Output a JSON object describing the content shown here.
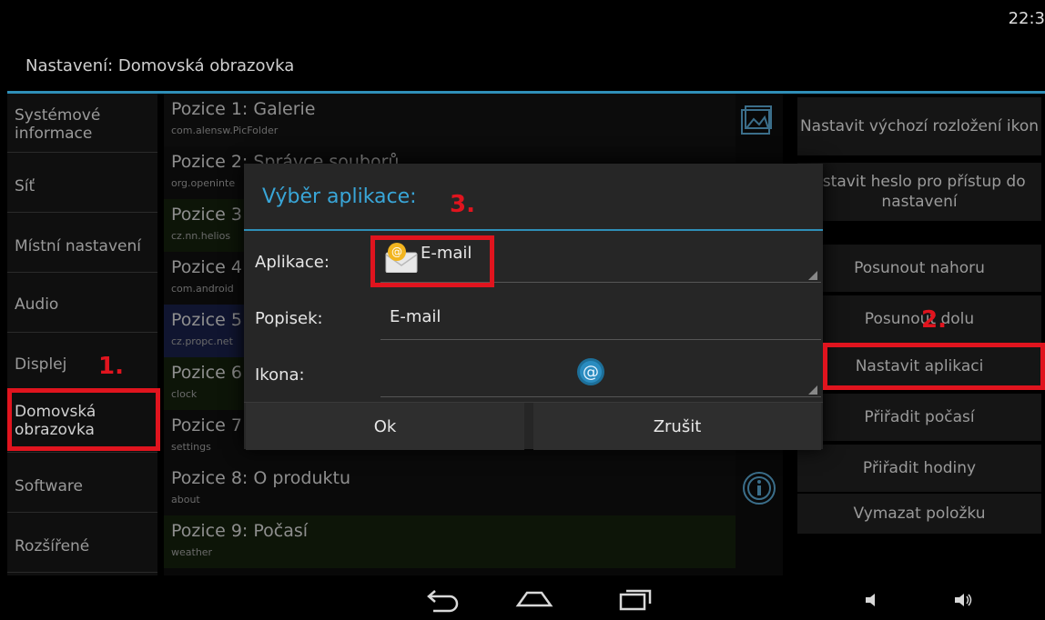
{
  "status_bar": {
    "clock": "22:3"
  },
  "header": {
    "title": "Nastavení: Domovská obrazovka"
  },
  "sidebar": {
    "items": [
      {
        "label": "Systémové informace"
      },
      {
        "label": "Síť"
      },
      {
        "label": "Místní nastavení"
      },
      {
        "label": "Audio"
      },
      {
        "label": "Displej"
      },
      {
        "label": "Domovská obrazovka"
      },
      {
        "label": "Software"
      },
      {
        "label": "Rozšířené"
      }
    ]
  },
  "positions": [
    {
      "name": "Pozice 1: Galerie",
      "package": "com.alensw.PicFolder",
      "icon": "gallery-icon"
    },
    {
      "name": "Pozice 2: Správce souborů",
      "package": "org.openinte"
    },
    {
      "name": "Pozice 3",
      "package": "cz.nn.helios"
    },
    {
      "name": "Pozice 4",
      "package": "com.android"
    },
    {
      "name": "Pozice 5",
      "package": "cz.propc.net"
    },
    {
      "name": "Pozice 6",
      "package": "clock"
    },
    {
      "name": "Pozice 7",
      "package": "settings"
    },
    {
      "name": "Pozice 8: O produktu",
      "package": "about",
      "icon": "info-icon"
    },
    {
      "name": "Pozice 9: Počasí",
      "package": "weather"
    }
  ],
  "actions": {
    "set_default_layout": "Nastavit výchozí rozložení ikon",
    "set_password": "astavit heslo pro přístup do nastavení",
    "move_up": "Posunout nahoru",
    "move_down": "Posunout dolu",
    "set_app": "Nastavit aplikaci",
    "assign_weather": "Přiřadit počasí",
    "assign_clock": "Přiřadit hodiny",
    "delete_item": "Vymazat položku"
  },
  "dialog": {
    "title": "Výběr aplikace:",
    "app_label": "Aplikace:",
    "app_value": "E-mail",
    "desc_label": "Popisek:",
    "desc_value": "E-mail",
    "icon_label": "Ikona:",
    "ok": "Ok",
    "cancel": "Zrušit"
  },
  "annotations": {
    "step1": "1.",
    "step2": "2.",
    "step3": "3."
  },
  "colors": {
    "accent": "#2f8fb8",
    "dialog_title": "#39a6d8",
    "annotation": "#e0141e"
  }
}
